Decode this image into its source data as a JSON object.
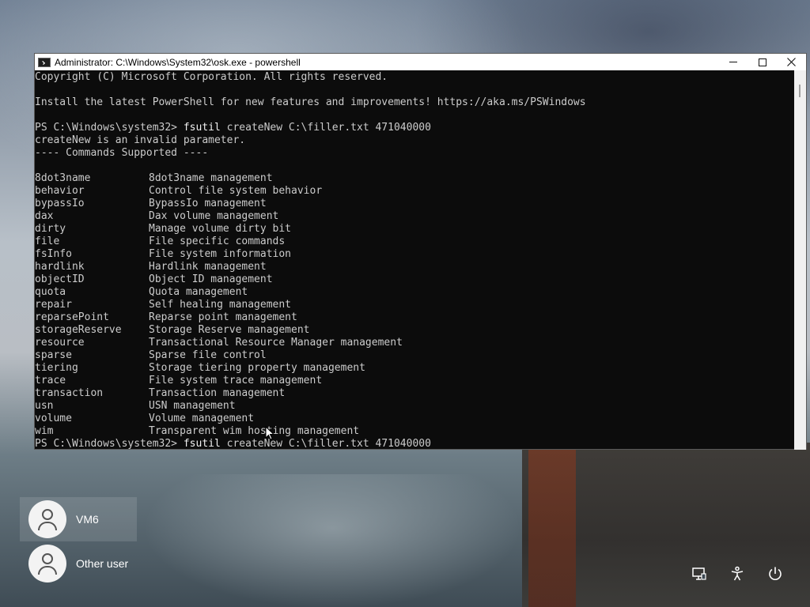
{
  "window": {
    "title": "Administrator: C:\\Windows\\System32\\osk.exe - powershell",
    "controls": {
      "minimize": "minimize-icon",
      "maximize": "maximize-icon",
      "close": "close-icon"
    }
  },
  "console": {
    "header_lines": [
      "Copyright (C) Microsoft Corporation. All rights reserved.",
      "",
      "Install the latest PowerShell for new features and improvements! https://aka.ms/PSWindows",
      ""
    ],
    "prompt1": {
      "path": "PS C:\\Windows\\system32> ",
      "cmd": "fsutil",
      "args": " createNew C:\\filler.txt 471040000"
    },
    "error_line": "createNew is an invalid parameter.",
    "commands_header": "---- Commands Supported ----",
    "commands": [
      {
        "name": "8dot3name",
        "desc": "8dot3name management"
      },
      {
        "name": "behavior",
        "desc": "Control file system behavior"
      },
      {
        "name": "bypassIo",
        "desc": "BypassIo management"
      },
      {
        "name": "dax",
        "desc": "Dax volume management"
      },
      {
        "name": "dirty",
        "desc": "Manage volume dirty bit"
      },
      {
        "name": "file",
        "desc": "File specific commands"
      },
      {
        "name": "fsInfo",
        "desc": "File system information"
      },
      {
        "name": "hardlink",
        "desc": "Hardlink management"
      },
      {
        "name": "objectID",
        "desc": "Object ID management"
      },
      {
        "name": "quota",
        "desc": "Quota management"
      },
      {
        "name": "repair",
        "desc": "Self healing management"
      },
      {
        "name": "reparsePoint",
        "desc": "Reparse point management"
      },
      {
        "name": "storageReserve",
        "desc": "Storage Reserve management"
      },
      {
        "name": "resource",
        "desc": "Transactional Resource Manager management"
      },
      {
        "name": "sparse",
        "desc": "Sparse file control"
      },
      {
        "name": "tiering",
        "desc": "Storage tiering property management"
      },
      {
        "name": "trace",
        "desc": "File system trace management"
      },
      {
        "name": "transaction",
        "desc": "Transaction management"
      },
      {
        "name": "usn",
        "desc": "USN management"
      },
      {
        "name": "volume",
        "desc": "Volume management"
      },
      {
        "name": "wim",
        "desc": "Transparent wim hosting management"
      }
    ],
    "prompt2": {
      "path": "PS C:\\Windows\\system32> ",
      "cmd": "fsutil",
      "args": " createNew C:\\filler.txt 471040000"
    }
  },
  "users": [
    {
      "name": "VM6",
      "selected": true
    },
    {
      "name": "Other user",
      "selected": false
    }
  ],
  "system_icons": [
    "network-icon",
    "accessibility-icon",
    "power-icon"
  ]
}
